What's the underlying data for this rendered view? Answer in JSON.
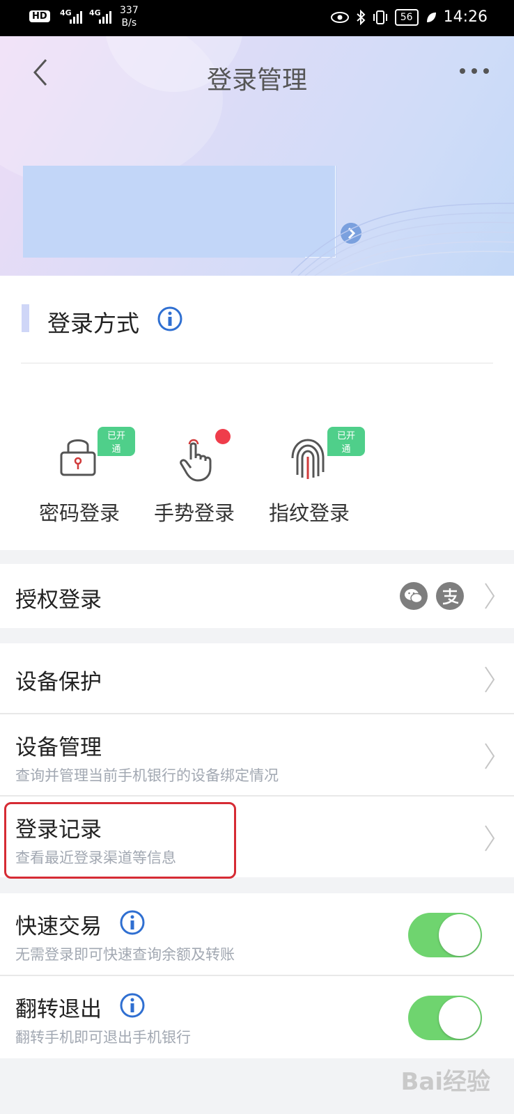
{
  "status_bar": {
    "hd": "HD",
    "network_a": "4G",
    "network_b": "4G",
    "speed_value": "337",
    "speed_unit": "B/s",
    "battery": "56",
    "time": "14:26"
  },
  "header": {
    "title": "登录管理"
  },
  "login_methods": {
    "title": "登录方式",
    "items": [
      {
        "label": "密码登录",
        "badge": "已开通",
        "icon": "lock-icon"
      },
      {
        "label": "手势登录",
        "badge": "",
        "icon": "gesture-icon"
      },
      {
        "label": "指纹登录",
        "badge": "已开通",
        "icon": "fingerprint-icon"
      }
    ]
  },
  "rows": {
    "auth_login": {
      "title": "授权登录"
    },
    "device_protect": {
      "title": "设备保护"
    },
    "device_manage": {
      "title": "设备管理",
      "subtitle": "查询并管理当前手机银行的设备绑定情况"
    },
    "login_record": {
      "title": "登录记录",
      "subtitle": "查看最近登录渠道等信息"
    },
    "quick_trade": {
      "title": "快速交易",
      "subtitle": "无需登录即可快速查询余额及转账",
      "enabled": true
    },
    "flip_exit": {
      "title": "翻转退出",
      "subtitle": "翻转手机即可退出手机银行",
      "enabled": true
    }
  },
  "watermark": "Bai经验",
  "colors": {
    "toggle_on": "#6fd46f",
    "badge": "#4fcf8a",
    "highlight": "#d62b34",
    "info_icon": "#2f6fd1"
  }
}
